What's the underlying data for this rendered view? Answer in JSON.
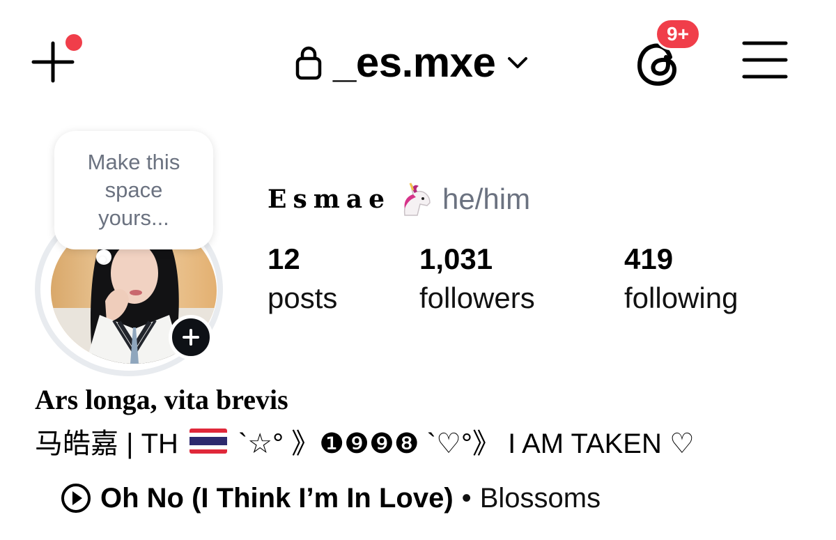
{
  "header": {
    "username": "_es.mxe",
    "notification_badge": "9+"
  },
  "profile": {
    "display_name": "Esmae",
    "pronouns": "he/him",
    "note_bubble": {
      "line1": "Make this",
      "line2": "space",
      "line3": "yours..."
    },
    "stats": [
      {
        "value": "12",
        "label": "posts"
      },
      {
        "value": "1,031",
        "label": "followers"
      },
      {
        "value": "419",
        "label": "following"
      }
    ]
  },
  "bio": {
    "title": "Ars longa, vita brevis",
    "line_prefix": "马皓嘉 | TH",
    "line_suffix": "`☆° 》❶❾❾❽ `♡°》 I AM TAKEN ♡"
  },
  "music": {
    "song": "Oh No (I Think I’m In Love)",
    "separator": "•",
    "artist": "Blossoms"
  },
  "colors": {
    "badge": "#f03e4a",
    "notification_dot": "#f03e4a",
    "muted_text": "#6b7280",
    "story_ring": "#e8ebef"
  }
}
